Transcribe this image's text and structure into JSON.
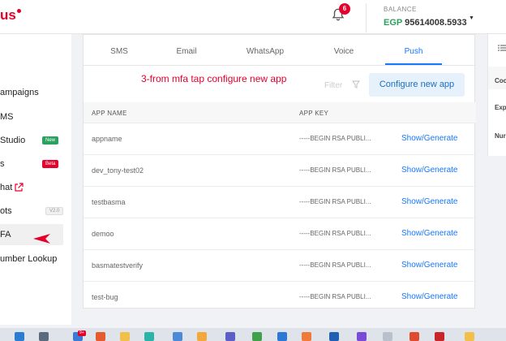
{
  "header": {
    "logo_text": "us",
    "notifications_count": "6",
    "balance_label": "BALANCE",
    "balance_currency": "EGP",
    "balance_amount": "95614008.5933"
  },
  "sidebar": {
    "items": [
      {
        "label": "ampaigns"
      },
      {
        "label": "MS"
      },
      {
        "label": "Studio",
        "badge": "New"
      },
      {
        "label": "s",
        "badge": "Beta"
      },
      {
        "label": "hat"
      },
      {
        "label": "ots",
        "badge": "V2.0"
      },
      {
        "label": "FA"
      },
      {
        "label": "umber Lookup"
      }
    ]
  },
  "tabs": [
    {
      "label": "SMS"
    },
    {
      "label": "Email"
    },
    {
      "label": "WhatsApp"
    },
    {
      "label": "Voice"
    },
    {
      "label": "Push",
      "active": true
    }
  ],
  "annotation": "3-from mfa tap configure new app",
  "filter_label": "Filter",
  "configure_button": "Configure new app",
  "table": {
    "headers": {
      "app_name": "APP NAME",
      "app_key": "APP KEY"
    },
    "rows": [
      {
        "name": "appname",
        "key": "-----BEGIN RSA PUBLI...",
        "action": "Show/Generate"
      },
      {
        "name": "dev_tony-test02",
        "key": "-----BEGIN RSA PUBLI...",
        "action": "Show/Generate"
      },
      {
        "name": "testbasma",
        "key": "-----BEGIN RSA PUBLI...",
        "action": "Show/Generate"
      },
      {
        "name": "demoo",
        "key": "-----BEGIN RSA PUBLI...",
        "action": "Show/Generate"
      },
      {
        "name": "basmatestverify",
        "key": "-----BEGIN RSA PUBLI...",
        "action": "Show/Generate"
      },
      {
        "name": "test-bug",
        "key": "-----BEGIN RSA PUBLI...",
        "action": "Show/Generate"
      }
    ]
  },
  "right_panel": {
    "labels": [
      "Coc",
      "Exp",
      "Nur"
    ]
  },
  "colors": {
    "brand": "#e4002b",
    "link": "#1677ff",
    "balance_green": "#2aa15d"
  }
}
